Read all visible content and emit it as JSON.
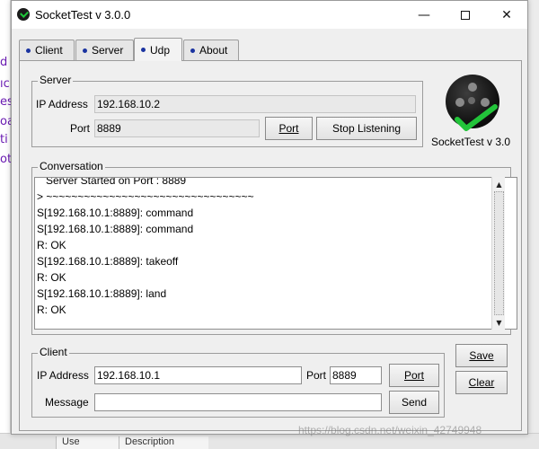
{
  "window": {
    "title": "SocketTest v 3.0.0",
    "minimize_glyph": "—",
    "close_glyph": "✕"
  },
  "tabs": [
    {
      "label": "Client",
      "active": false
    },
    {
      "label": "Server",
      "active": false
    },
    {
      "label": "Udp",
      "active": true
    },
    {
      "label": "About",
      "active": false
    }
  ],
  "server": {
    "group_title": "Server",
    "ip_label": "IP Address",
    "ip_value": "192.168.10.2",
    "port_label": "Port",
    "port_value": "8889",
    "port_button": "Port",
    "stop_button": "Stop Listening"
  },
  "logo": {
    "caption": "SocketTest v 3.0",
    "check_color": "#22c43a"
  },
  "conversation": {
    "group_title": "Conversation",
    "lines": [
      "   Server Started on Port : 8889",
      "> ~~~~~~~~~~~~~~~~~~~~~~~~~~~~~~~~~",
      "S[192.168.10.1:8889]: command",
      "S[192.168.10.1:8889]: command",
      "R: OK",
      "S[192.168.10.1:8889]: takeoff",
      "R: OK",
      "S[192.168.10.1:8889]: land",
      "R: OK"
    ]
  },
  "client": {
    "group_title": "Client",
    "ip_label": "IP Address",
    "ip_value": "192.168.10.1",
    "port_label": "Port",
    "port_value": "8889",
    "port_button": "Port",
    "message_label": "Message",
    "message_value": "",
    "send_button": "Send"
  },
  "side_buttons": {
    "save": "Save",
    "clear": "Clear"
  },
  "background": {
    "left_chars": [
      "d",
      "ıc",
      "es",
      "oa",
      "ti",
      "ot"
    ],
    "bottom_cells": [
      "Use",
      "Description"
    ],
    "watermark": "https://blog.csdn.net/weixin_42749948"
  }
}
